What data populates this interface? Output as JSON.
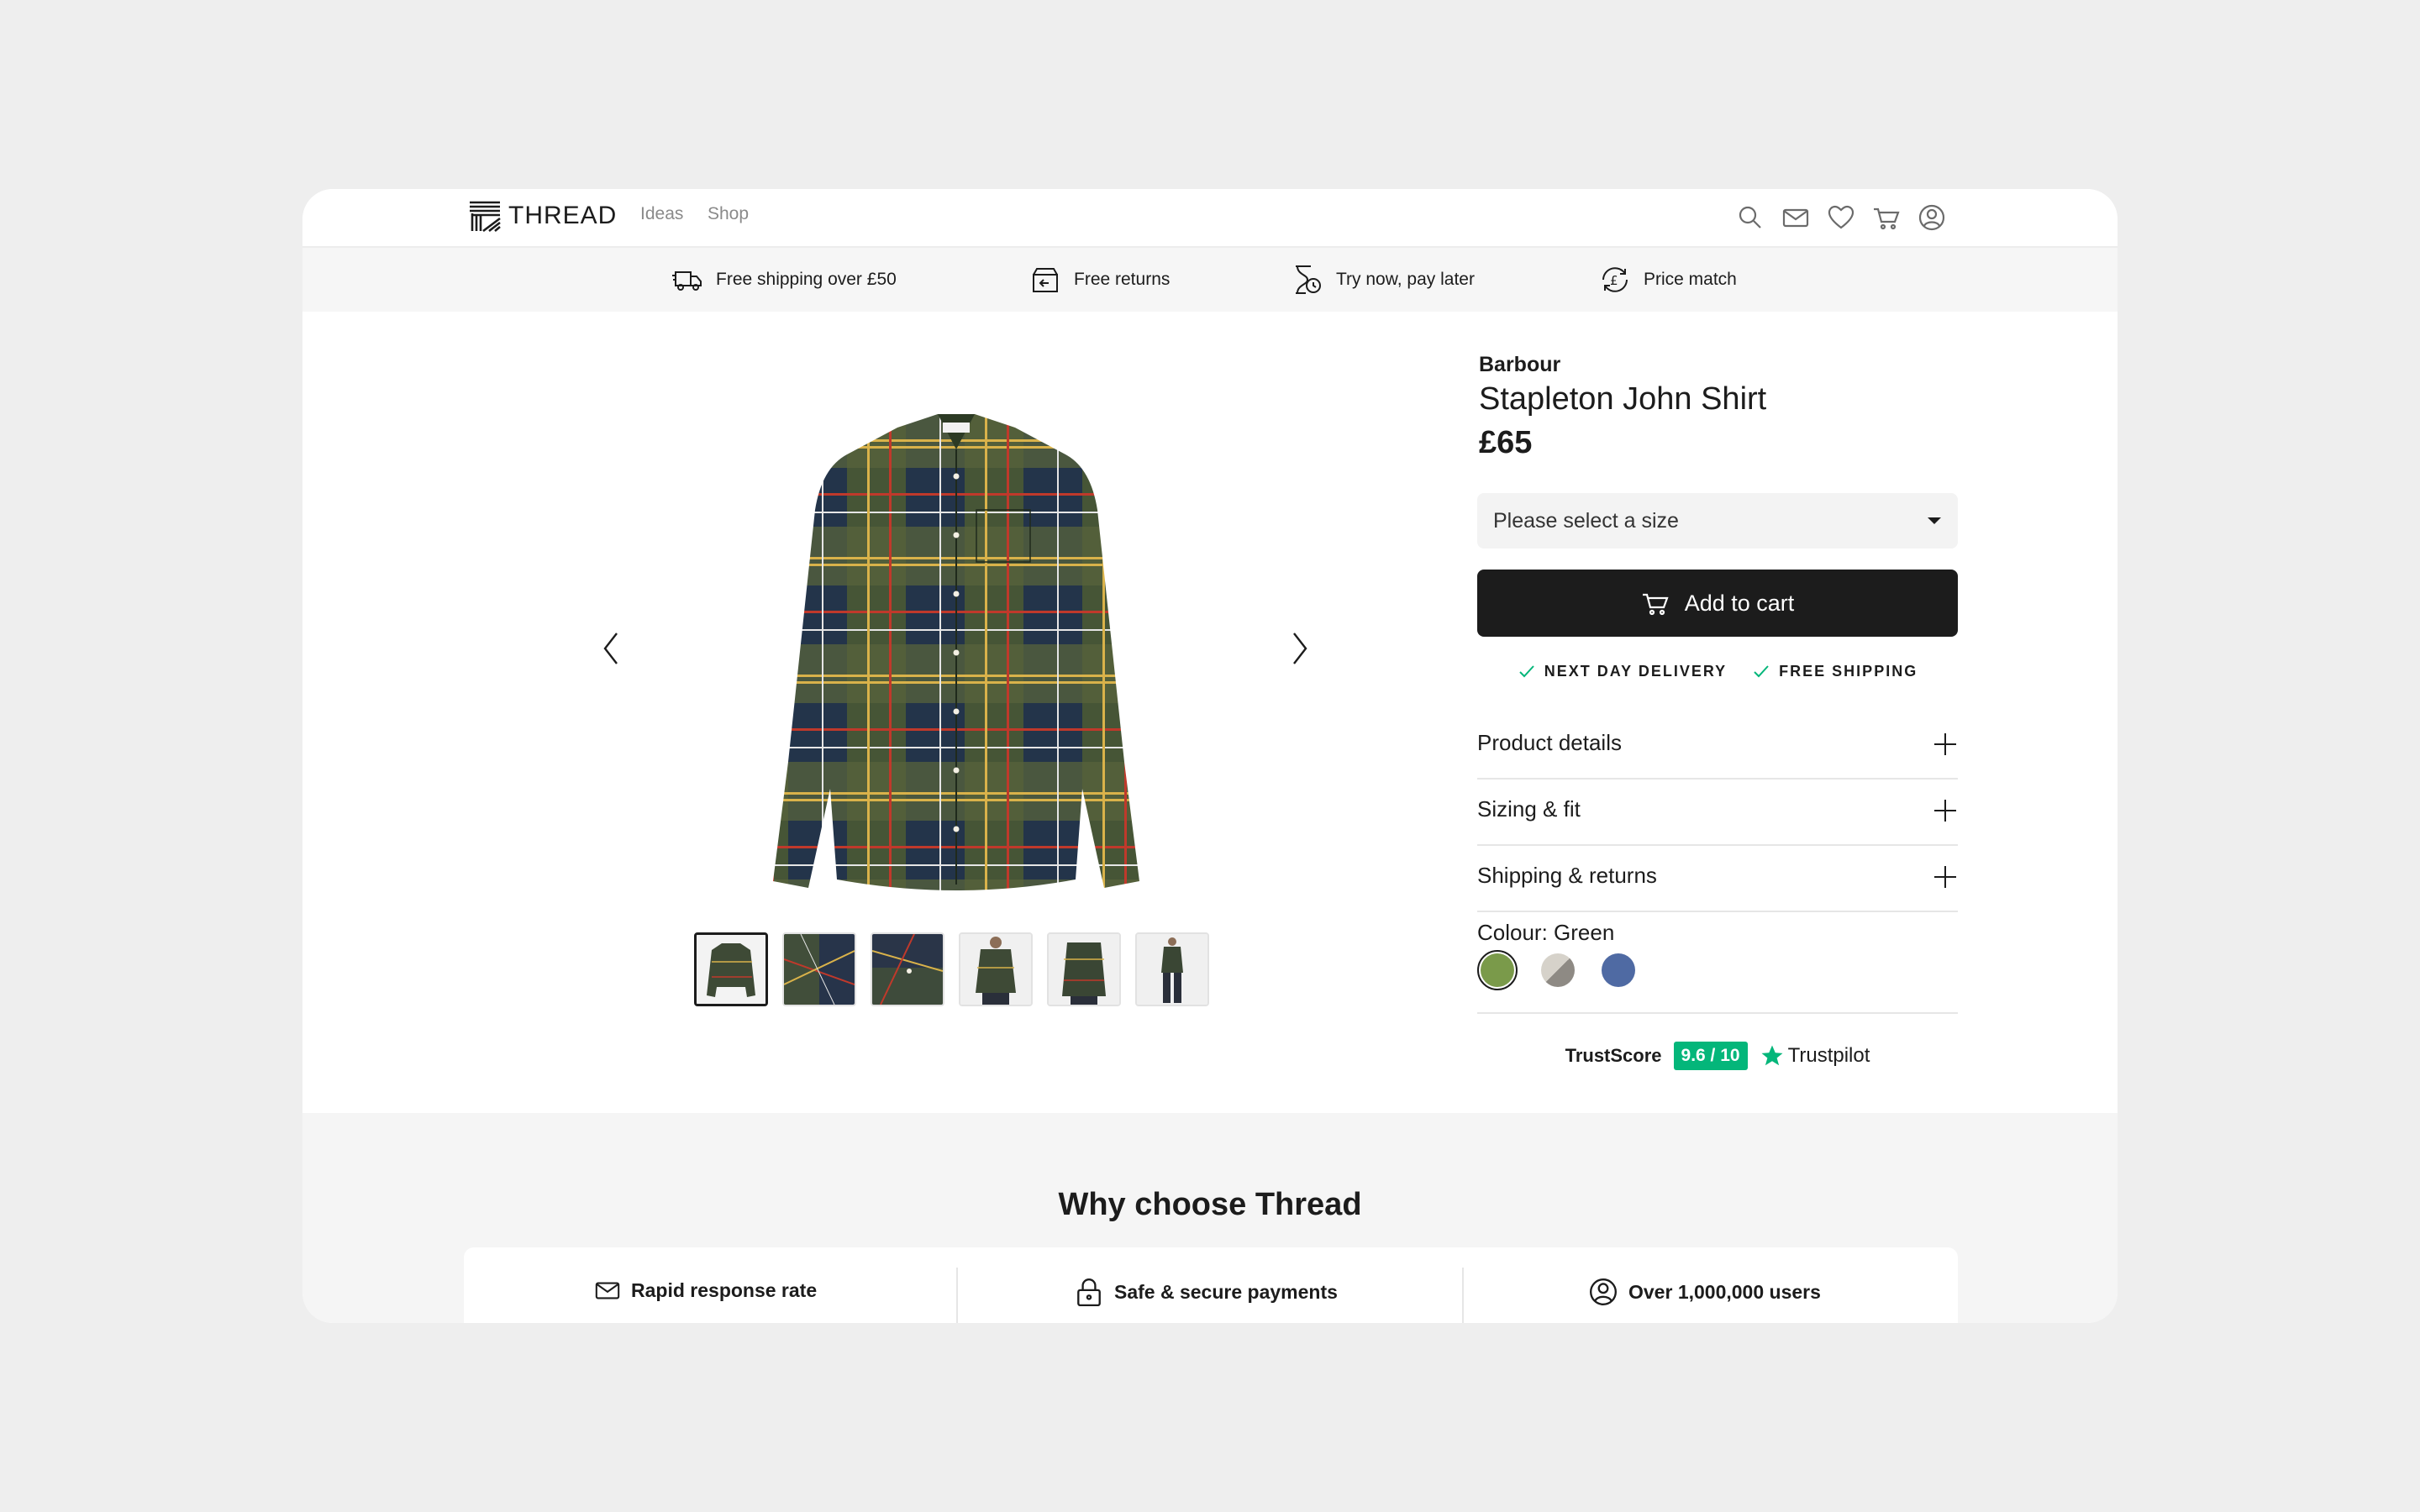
{
  "header": {
    "logo_text": "THREAD",
    "nav": [
      {
        "label": "Ideas"
      },
      {
        "label": "Shop"
      }
    ],
    "icons": [
      "search-icon",
      "mail-icon",
      "heart-icon",
      "cart-icon",
      "account-icon"
    ]
  },
  "benefits": [
    {
      "label": "Free shipping over £50",
      "icon": "truck-icon"
    },
    {
      "label": "Free returns",
      "icon": "returns-box-icon"
    },
    {
      "label": "Try now, pay later",
      "icon": "hourglass-clock-icon"
    },
    {
      "label": "Price match",
      "icon": "pound-refresh-icon"
    }
  ],
  "product": {
    "brand": "Barbour",
    "name": "Stapleton John Shirt",
    "price": "£65",
    "size_select": "Please select a size",
    "add_to_cart": "Add to cart",
    "delivery": [
      "NEXT DAY DELIVERY",
      "FREE SHIPPING"
    ],
    "accordions": [
      {
        "label": "Product details"
      },
      {
        "label": "Sizing & fit"
      },
      {
        "label": "Shipping & returns"
      }
    ],
    "colour_label": "Colour: Green",
    "swatches": [
      {
        "name": "Green",
        "color": "#7a9a4a",
        "selected": true
      },
      {
        "name": "Grey",
        "color": "#b0aea8",
        "selected": false
      },
      {
        "name": "Blue",
        "color": "#4f6aa3",
        "selected": false
      }
    ],
    "thumbnails": 6,
    "active_thumbnail": 1
  },
  "trust": {
    "label": "TrustScore",
    "score": "9.6 / 10",
    "brand": "Trustpilot",
    "brand_color": "#04b67a"
  },
  "why": {
    "title": "Why choose Thread",
    "items": [
      {
        "label": "Rapid response rate",
        "icon": "mail-icon"
      },
      {
        "label": "Safe & secure payments",
        "icon": "padlock-icon"
      },
      {
        "label": "Over 1,000,000 users",
        "icon": "user-circle-icon"
      }
    ]
  },
  "colors": {
    "accent_dark": "#1c1c1c",
    "page_bg": "#eeeeee",
    "band_bg": "#f6f6f6"
  }
}
